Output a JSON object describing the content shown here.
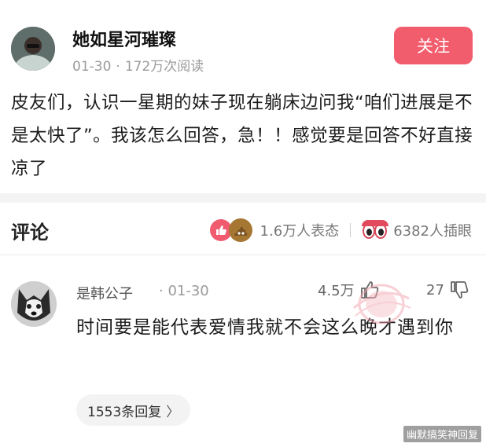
{
  "post": {
    "author": "她如星河璀璨",
    "date": "01-30",
    "separator": "·",
    "views": "172万次阅读",
    "follow_label": "关注",
    "body": "皮友们，认识一星期的妹子现在躺床边问我“咱们进展是不是太快了”。我该怎么回答，急！！感觉要是回答不好直接凉了"
  },
  "comments_section": {
    "title": "评论",
    "reactions_count": "1.6万人表态",
    "poke_count": "6382人插眼"
  },
  "comment": {
    "user": "是韩公子",
    "date": "· 01-30",
    "likes": "4.5万",
    "dislikes": "27",
    "text": "时间要是能代表爱情我就不会这么晚才遇到你",
    "replies_label": "1553条回复",
    "chevron": "〉"
  },
  "watermark": "幽默搞笑神回复",
  "colors": {
    "accent": "#f25d6e",
    "meta_gray": "#9a9a9a"
  },
  "icons": [
    "author-avatar",
    "like-emoji-icon",
    "poop-emoji-icon",
    "eyes-emoji-icon",
    "thumb-up-icon",
    "thumb-down-icon",
    "chevron-right-icon"
  ]
}
